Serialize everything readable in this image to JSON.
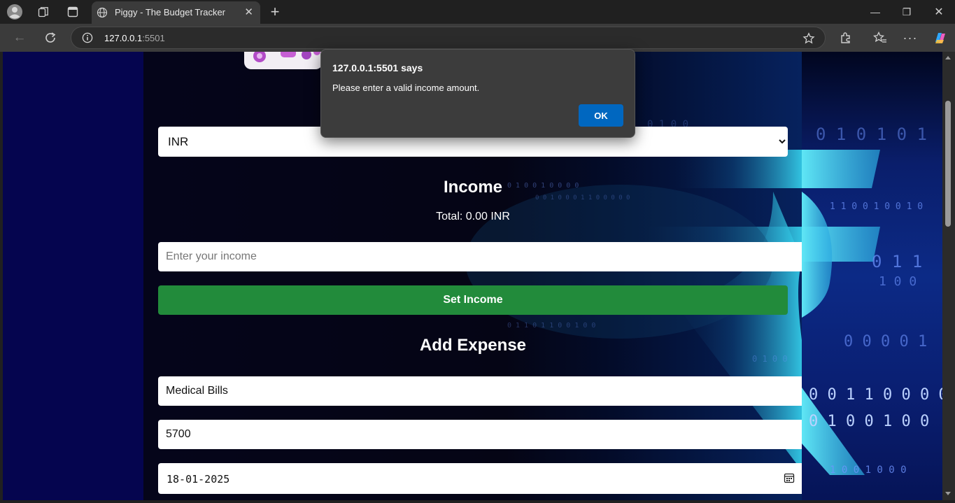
{
  "browser": {
    "tab_title": "Piggy - The Budget Tracker",
    "url_host": "127.0.0.1",
    "url_port": ":5501",
    "icons": [
      "profile-icon",
      "workspaces-icon",
      "tab-actions-icon",
      "globe-icon",
      "close-icon",
      "new-tab-icon",
      "back-icon",
      "reload-icon",
      "info-icon",
      "favorite-star-icon",
      "extensions-icon",
      "favorites-icon",
      "more-icon",
      "copilot-icon"
    ]
  },
  "app": {
    "currency_selected": "INR",
    "income_heading": "Income",
    "income_total": "Total: 0.00 INR",
    "income_placeholder": "Enter your income",
    "set_income_label": "Set Income",
    "expense_heading": "Add Expense",
    "expense_name_value": "Medical Bills",
    "expense_amount_value": "5700",
    "expense_date_value": "18-01-2025"
  },
  "dialog": {
    "title": "127.0.0.1:5501 says",
    "message": "Please enter a valid income amount.",
    "ok_label": "OK"
  },
  "colors": {
    "accent_button": "#228b3b",
    "dialog_ok": "#0067c0",
    "page_sides": "#05054f"
  }
}
